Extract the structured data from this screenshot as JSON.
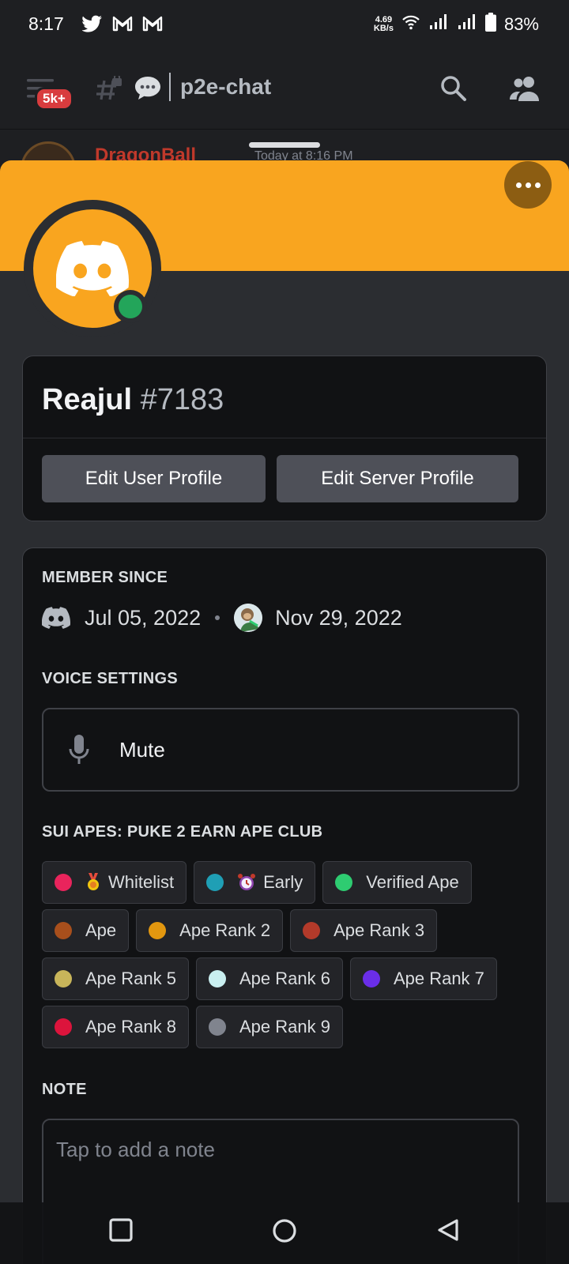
{
  "status_bar": {
    "time": "8:17",
    "speed_value": "4.69",
    "speed_unit": "KB/s",
    "battery": "83%",
    "notification_icons": [
      "twitter-icon",
      "gmail-icon",
      "gmail-icon"
    ]
  },
  "channel_header": {
    "unread_badge": "5k+",
    "channel_name": "p2e-chat"
  },
  "background_message": {
    "author": "DragonBall",
    "time": "Today at 8:16 PM"
  },
  "profile": {
    "username": "Reajul",
    "discriminator": "#7183",
    "status": "online",
    "banner_color": "#f9a51f",
    "buttons": {
      "edit_user": "Edit User Profile",
      "edit_server": "Edit Server Profile"
    }
  },
  "member_since": {
    "title": "MEMBER SINCE",
    "discord_date": "Jul 05, 2022",
    "server_date": "Nov 29, 2022"
  },
  "voice": {
    "title": "VOICE SETTINGS",
    "mute_label": "Mute"
  },
  "roles": {
    "title": "SUI APES: PUKE 2 EARN APE CLUB",
    "items": [
      {
        "label": "Whitelist",
        "color": "#e9245c",
        "emoji": "medal-icon"
      },
      {
        "label": "Early",
        "color": "#1f9fb5",
        "emoji": "alarm-clock-icon"
      },
      {
        "label": "Verified Ape",
        "color": "#2ecc71"
      },
      {
        "label": "Ape",
        "color": "#a84f1c"
      },
      {
        "label": "Ape Rank 2",
        "color": "#e2970f"
      },
      {
        "label": "Ape Rank 3",
        "color": "#b33a2a"
      },
      {
        "label": "Ape Rank 5",
        "color": "#c8b55a"
      },
      {
        "label": "Ape Rank 6",
        "color": "#c9eff0"
      },
      {
        "label": "Ape Rank 7",
        "color": "#6a2ee8"
      },
      {
        "label": "Ape Rank 8",
        "color": "#dc143c"
      },
      {
        "label": "Ape Rank 9",
        "color": "#80848e"
      }
    ]
  },
  "note": {
    "title": "NOTE",
    "placeholder": "Tap to add a note"
  }
}
